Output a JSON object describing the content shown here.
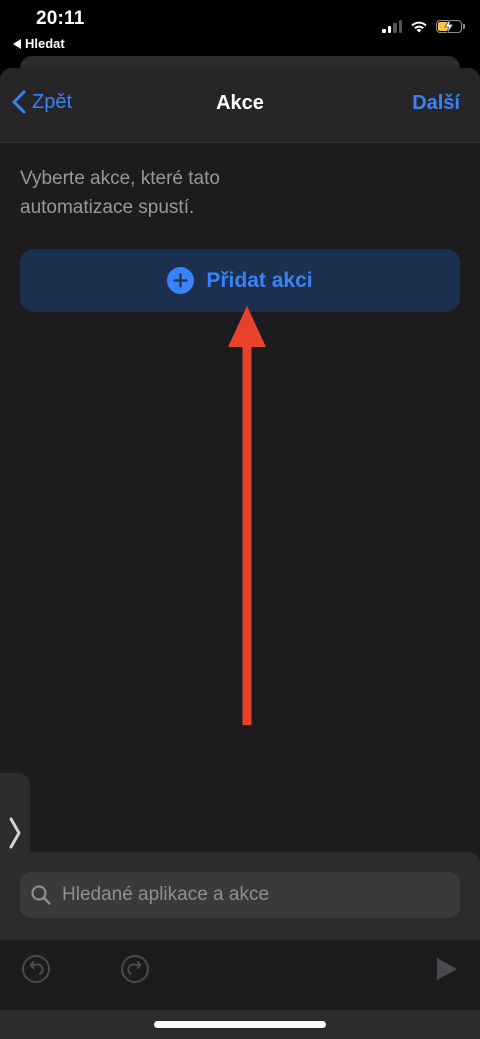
{
  "status_bar": {
    "time": "20:11",
    "back_app_label": "Hledat",
    "battery_color": "#f7c843"
  },
  "navbar": {
    "back_label": "Zpět",
    "title": "Akce",
    "next_label": "Další"
  },
  "content": {
    "instruction": "Vyberte akce, které tato automatizace spustí.",
    "add_action_label": "Přidat akci"
  },
  "search": {
    "placeholder": "Hledané aplikace a akce"
  },
  "toolbar": {
    "undo_icon": "undo-icon",
    "redo_icon": "redo-icon",
    "play_icon": "play-icon"
  },
  "colors": {
    "accent": "#3a82f7",
    "annotation": "#e8412c",
    "background": "#1c1c1e"
  }
}
